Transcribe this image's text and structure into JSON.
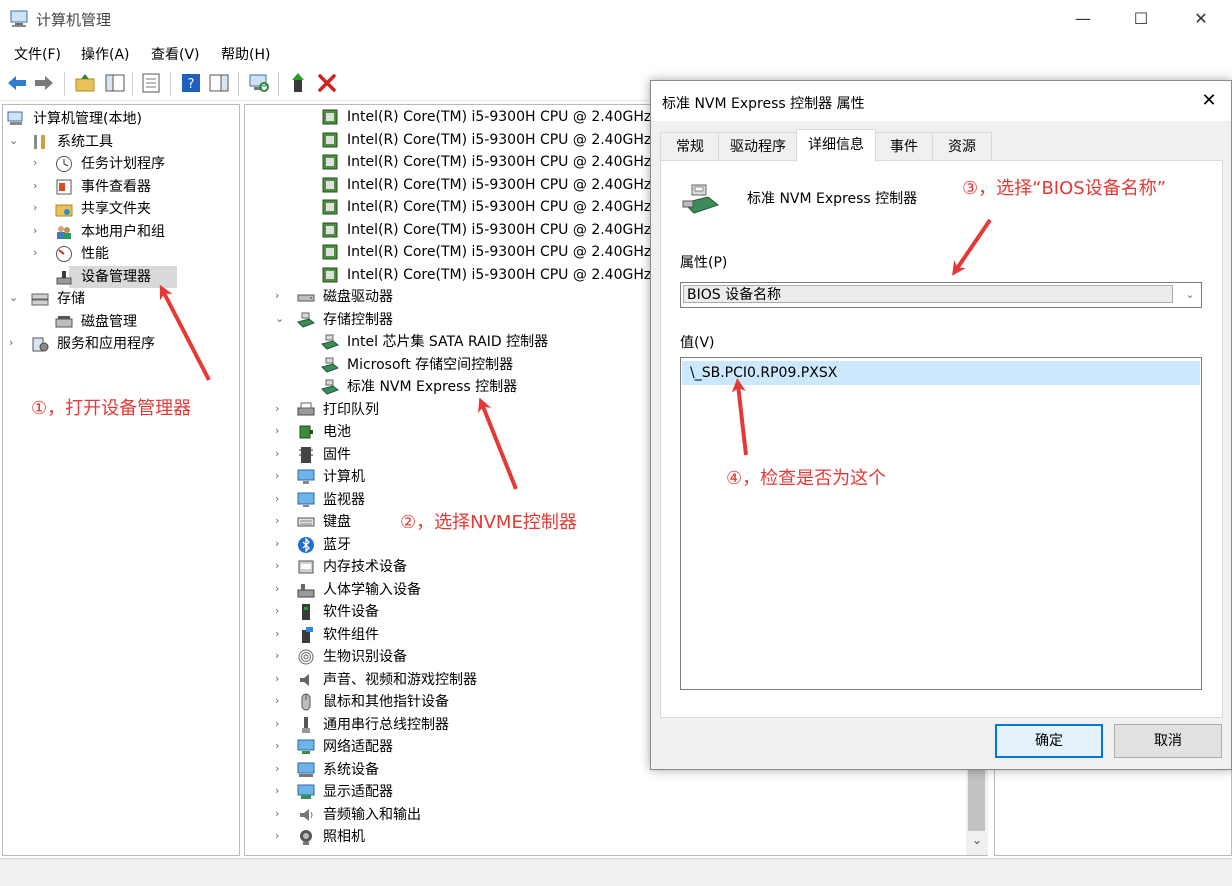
{
  "window": {
    "title": "计算机管理",
    "minimize": "—",
    "maximize": "☐",
    "close": "✕"
  },
  "menu": [
    "文件(F)",
    "操作(A)",
    "查看(V)",
    "帮助(H)"
  ],
  "left_tree": [
    {
      "label": "计算机管理(本地)",
      "level": 0,
      "arrow": "",
      "icon": "computer-management-icon"
    },
    {
      "label": "系统工具",
      "level": 1,
      "arrow": "⌄",
      "icon": "tools-icon"
    },
    {
      "label": "任务计划程序",
      "level": 2,
      "arrow": "›",
      "icon": "clock-icon"
    },
    {
      "label": "事件查看器",
      "level": 2,
      "arrow": "›",
      "icon": "event-viewer-icon"
    },
    {
      "label": "共享文件夹",
      "level": 2,
      "arrow": "›",
      "icon": "shared-folder-icon"
    },
    {
      "label": "本地用户和组",
      "level": 2,
      "arrow": "›",
      "icon": "users-icon"
    },
    {
      "label": "性能",
      "level": 2,
      "arrow": "›",
      "icon": "performance-icon"
    },
    {
      "label": "设备管理器",
      "level": 2,
      "arrow": "",
      "icon": "device-manager-icon",
      "selected": true
    },
    {
      "label": "存储",
      "level": 1,
      "arrow": "⌄",
      "icon": "storage-icon"
    },
    {
      "label": "磁盘管理",
      "level": 2,
      "arrow": "",
      "icon": "disk-management-icon"
    },
    {
      "label": "服务和应用程序",
      "level": 1,
      "arrow": "›",
      "icon": "services-icon"
    }
  ],
  "device_tree": [
    {
      "label": "Intel(R) Core(TM) i5-9300H CPU @ 2.40GHz",
      "level": 2,
      "arrow": "",
      "icon": "cpu-icon"
    },
    {
      "label": "Intel(R) Core(TM) i5-9300H CPU @ 2.40GHz",
      "level": 2,
      "arrow": "",
      "icon": "cpu-icon"
    },
    {
      "label": "Intel(R) Core(TM) i5-9300H CPU @ 2.40GHz",
      "level": 2,
      "arrow": "",
      "icon": "cpu-icon"
    },
    {
      "label": "Intel(R) Core(TM) i5-9300H CPU @ 2.40GHz",
      "level": 2,
      "arrow": "",
      "icon": "cpu-icon"
    },
    {
      "label": "Intel(R) Core(TM) i5-9300H CPU @ 2.40GHz",
      "level": 2,
      "arrow": "",
      "icon": "cpu-icon"
    },
    {
      "label": "Intel(R) Core(TM) i5-9300H CPU @ 2.40GHz",
      "level": 2,
      "arrow": "",
      "icon": "cpu-icon"
    },
    {
      "label": "Intel(R) Core(TM) i5-9300H CPU @ 2.40GHz",
      "level": 2,
      "arrow": "",
      "icon": "cpu-icon"
    },
    {
      "label": "Intel(R) Core(TM) i5-9300H CPU @ 2.40GHz",
      "level": 2,
      "arrow": "",
      "icon": "cpu-icon"
    },
    {
      "label": "磁盘驱动器",
      "level": 1,
      "arrow": "›",
      "icon": "disk-drive-icon"
    },
    {
      "label": "存储控制器",
      "level": 1,
      "arrow": "⌄",
      "icon": "storage-controller-icon"
    },
    {
      "label": "Intel 芯片集 SATA RAID 控制器",
      "level": 2,
      "arrow": "",
      "icon": "storage-controller-icon"
    },
    {
      "label": "Microsoft 存储空间控制器",
      "level": 2,
      "arrow": "",
      "icon": "storage-controller-icon"
    },
    {
      "label": "标准 NVM Express 控制器",
      "level": 2,
      "arrow": "",
      "icon": "storage-controller-icon"
    },
    {
      "label": "打印队列",
      "level": 1,
      "arrow": "›",
      "icon": "printer-icon"
    },
    {
      "label": "电池",
      "level": 1,
      "arrow": "›",
      "icon": "battery-icon"
    },
    {
      "label": "固件",
      "level": 1,
      "arrow": "›",
      "icon": "firmware-icon"
    },
    {
      "label": "计算机",
      "level": 1,
      "arrow": "›",
      "icon": "computer-icon"
    },
    {
      "label": "监视器",
      "level": 1,
      "arrow": "›",
      "icon": "monitor-icon"
    },
    {
      "label": "键盘",
      "level": 1,
      "arrow": "›",
      "icon": "keyboard-icon"
    },
    {
      "label": "蓝牙",
      "level": 1,
      "arrow": "›",
      "icon": "bluetooth-icon"
    },
    {
      "label": "内存技术设备",
      "level": 1,
      "arrow": "›",
      "icon": "memory-icon"
    },
    {
      "label": "人体学输入设备",
      "level": 1,
      "arrow": "›",
      "icon": "hid-icon"
    },
    {
      "label": "软件设备",
      "level": 1,
      "arrow": "›",
      "icon": "software-device-icon"
    },
    {
      "label": "软件组件",
      "level": 1,
      "arrow": "›",
      "icon": "software-component-icon"
    },
    {
      "label": "生物识别设备",
      "level": 1,
      "arrow": "›",
      "icon": "fingerprint-icon"
    },
    {
      "label": "声音、视频和游戏控制器",
      "level": 1,
      "arrow": "›",
      "icon": "speaker-icon"
    },
    {
      "label": "鼠标和其他指针设备",
      "level": 1,
      "arrow": "›",
      "icon": "mouse-icon"
    },
    {
      "label": "通用串行总线控制器",
      "level": 1,
      "arrow": "›",
      "icon": "usb-icon"
    },
    {
      "label": "网络适配器",
      "level": 1,
      "arrow": "›",
      "icon": "network-icon"
    },
    {
      "label": "系统设备",
      "level": 1,
      "arrow": "›",
      "icon": "system-device-icon"
    },
    {
      "label": "显示适配器",
      "level": 1,
      "arrow": "›",
      "icon": "display-adapter-icon"
    },
    {
      "label": "音频输入和输出",
      "level": 1,
      "arrow": "›",
      "icon": "audio-icon"
    },
    {
      "label": "照相机",
      "level": 1,
      "arrow": "›",
      "icon": "camera-icon"
    }
  ],
  "scrollbar": {
    "down_arrow": "⌄"
  },
  "dialog": {
    "title": "标准 NVM Express 控制器 属性",
    "close": "✕",
    "tabs": [
      "常规",
      "驱动程序",
      "详细信息",
      "事件",
      "资源"
    ],
    "active_tab": 2,
    "device_name": "标准 NVM Express 控制器",
    "property_label": "属性(P)",
    "property_value": "BIOS 设备名称",
    "property_chevron": "⌄",
    "value_label": "值(V)",
    "value": "\\_SB.PCI0.RP09.PXSX",
    "ok": "确定",
    "cancel": "取消"
  },
  "annotations": {
    "a1": "①，打开设备管理器",
    "a2": "②，选择NVME控制器",
    "a3": "③，选择“BIOS设备名称”",
    "a4": "④，检查是否为这个",
    "color": "#e53935"
  }
}
